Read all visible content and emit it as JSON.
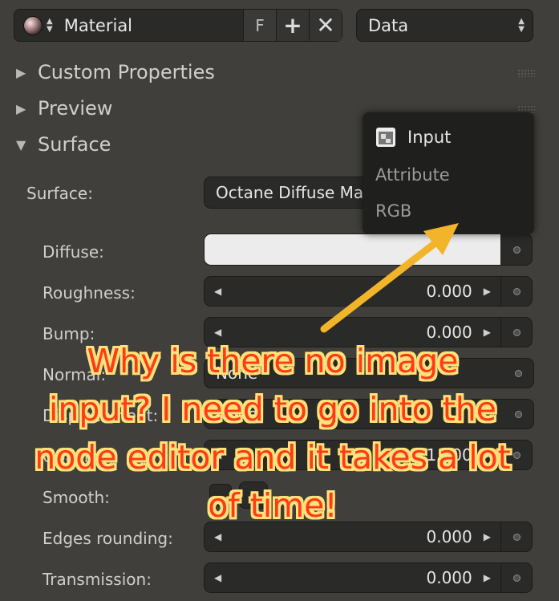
{
  "header": {
    "material_label": "Material",
    "fake_user_label": "F",
    "context": "Data"
  },
  "panels": {
    "custom_properties": "Custom Properties",
    "preview": "Preview",
    "surface": "Surface"
  },
  "surface": {
    "surface_label": "Surface:",
    "surface_value": "Octane Diffuse Mat",
    "diffuse_label": "Diffuse:",
    "diffuse_color": "#ececec",
    "roughness_label": "Roughness:",
    "roughness_value": "0.000",
    "bump_label": "Bump:",
    "bump_value": "0.000",
    "normal_label": "Normal:",
    "normal_value": "None",
    "displacement_label": "Displacement:",
    "displacement_value": "None",
    "opacity_label": "Opacity:",
    "opacity_value": "1.000",
    "smooth_label": "Smooth:",
    "edges_label": "Edges rounding:",
    "edges_value": "0.000",
    "transmission_label": "Transmission:",
    "transmission_value": "0.000"
  },
  "popup_menu": {
    "title": "Input",
    "items": [
      "Attribute",
      "RGB"
    ]
  },
  "annotation": {
    "text": "Why is there no image input? I need to go into the node editor and it takes a lot of time!",
    "arrow_color": "#f2b52a"
  }
}
